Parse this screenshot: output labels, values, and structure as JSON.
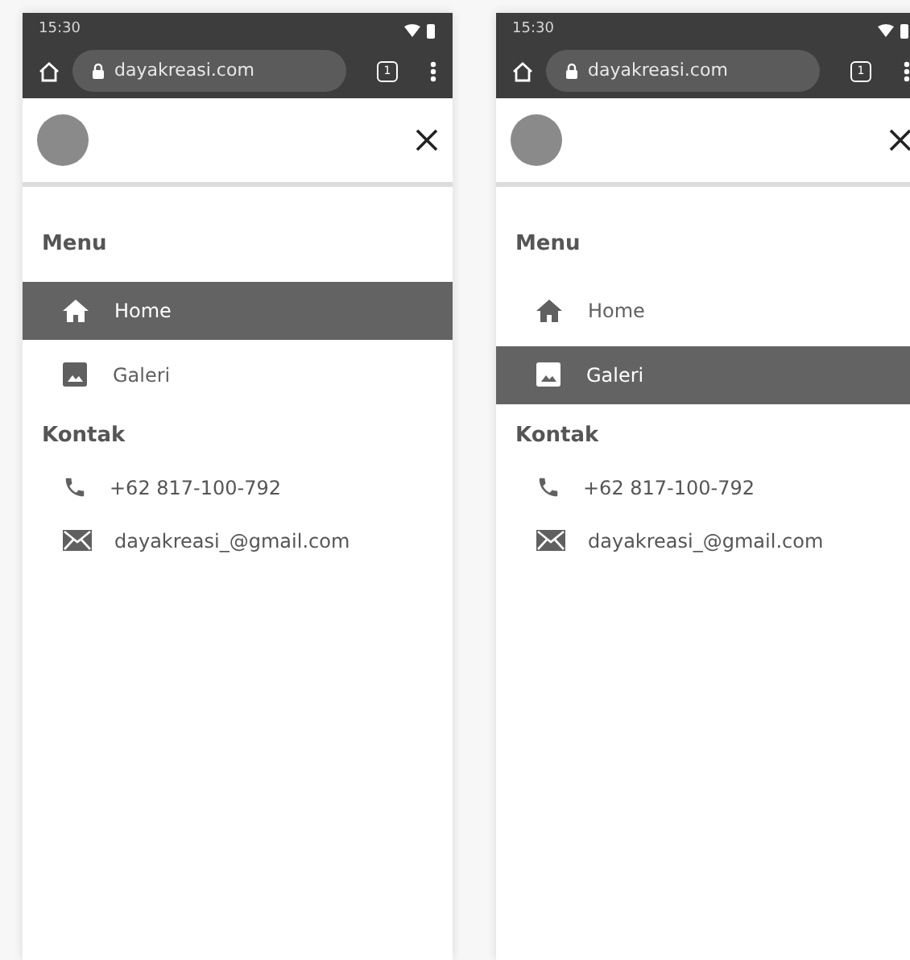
{
  "phones": [
    {
      "status_time": "15:30",
      "url": "dayakreasi.com",
      "tab_count": "1",
      "menu": {
        "title": "Menu",
        "items": [
          {
            "label": "Home",
            "kind": "home",
            "selected": true
          },
          {
            "label": "Galeri",
            "kind": "gallery",
            "selected": false
          }
        ]
      },
      "contact": {
        "title": "Kontak",
        "items": [
          {
            "kind": "phone",
            "text": "+62 817-100-792"
          },
          {
            "kind": "email",
            "text": "dayakreasi_@gmail.com"
          }
        ]
      }
    },
    {
      "status_time": "15:30",
      "url": "dayakreasi.com",
      "tab_count": "1",
      "menu": {
        "title": "Menu",
        "items": [
          {
            "label": "Home",
            "kind": "home",
            "selected": false
          },
          {
            "label": "Galeri",
            "kind": "gallery",
            "selected": true
          }
        ]
      },
      "contact": {
        "title": "Kontak",
        "items": [
          {
            "kind": "phone",
            "text": "+62 817-100-792"
          },
          {
            "kind": "email",
            "text": "dayakreasi_@gmail.com"
          }
        ]
      }
    }
  ]
}
